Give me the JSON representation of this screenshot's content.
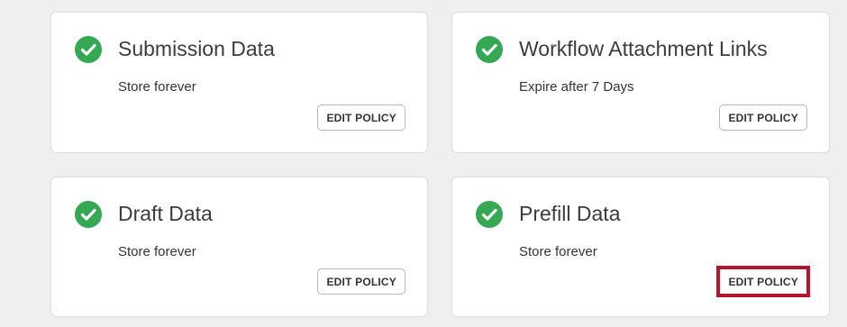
{
  "colors": {
    "check_green": "#34a853",
    "highlight_red": "#b3152c"
  },
  "cards": [
    {
      "title": "Submission Data",
      "description": "Store forever",
      "button_label": "EDIT POLICY",
      "icon": "check-circle-icon",
      "highlighted": false
    },
    {
      "title": "Workflow Attachment Links",
      "description": "Expire after 7 Days",
      "button_label": "EDIT POLICY",
      "icon": "check-circle-icon",
      "highlighted": false
    },
    {
      "title": "Draft Data",
      "description": "Store forever",
      "button_label": "EDIT POLICY",
      "icon": "check-circle-icon",
      "highlighted": false
    },
    {
      "title": "Prefill Data",
      "description": "Store forever",
      "button_label": "EDIT POLICY",
      "icon": "check-circle-icon",
      "highlighted": true
    }
  ]
}
